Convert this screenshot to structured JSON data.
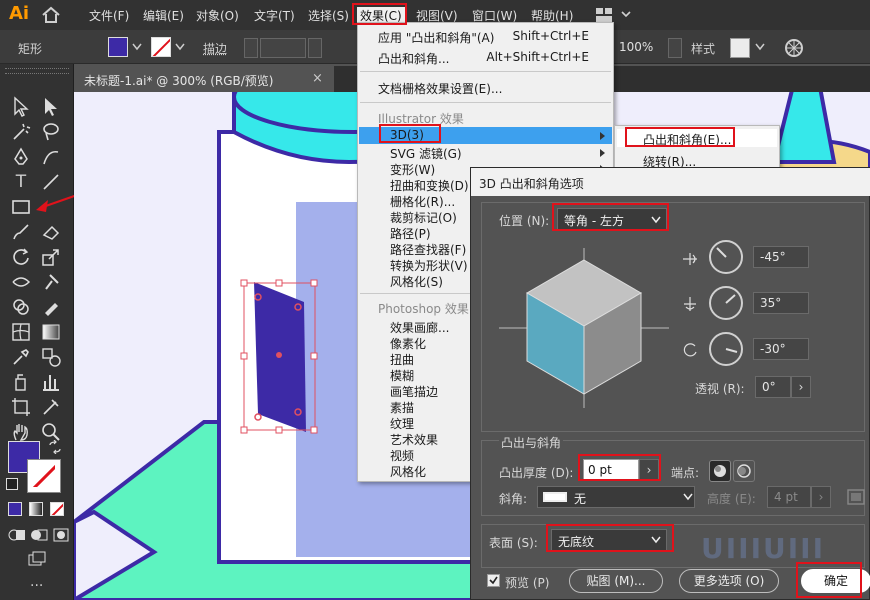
{
  "app": {
    "logo": "Ai",
    "home_icon": "home-icon"
  },
  "menubar": {
    "items": [
      {
        "label": "文件(F)"
      },
      {
        "label": "编辑(E)"
      },
      {
        "label": "对象(O)"
      },
      {
        "label": "文字(T)"
      },
      {
        "label": "选择(S)"
      },
      {
        "label": "效果(C)"
      },
      {
        "label": "视图(V)"
      },
      {
        "label": "窗口(W)"
      },
      {
        "label": "帮助(H)"
      }
    ]
  },
  "controlbar": {
    "object_type": "矩形",
    "stroke_label": "描边",
    "zoom": "100%",
    "style_label": "样式",
    "fill_color": "#3d2aa6"
  },
  "document_tab": {
    "title": "未标题-1.ai* @ 300% (RGB/预览)",
    "close": "×"
  },
  "effect_menu": {
    "apply": {
      "label": "应用 \"凸出和斜角\"(A)",
      "shortcut": "Shift+Ctrl+E"
    },
    "last": {
      "label": "凸出和斜角...",
      "shortcut": "Alt+Shift+Ctrl+E"
    },
    "raster_settings": "文档栅格效果设置(E)...",
    "illustrator_header": "Illustrator 效果",
    "illustrator_items": [
      "3D(3)",
      "SVG 滤镜(G)",
      "变形(W)",
      "扭曲和变换(D)",
      "栅格化(R)...",
      "裁剪标记(O)",
      "路径(P)",
      "路径查找器(F)",
      "转换为形状(V)",
      "风格化(S)"
    ],
    "photoshop_header": "Photoshop 效果",
    "photoshop_items": [
      "效果画廊...",
      "像素化",
      "扭曲",
      "模糊",
      "画笔描边",
      "素描",
      "纹理",
      "艺术效果",
      "视频",
      "风格化"
    ]
  },
  "submenu_3d": {
    "items": [
      "凸出和斜角(E)...",
      "绕转(R)..."
    ]
  },
  "dialog": {
    "title": "3D 凸出和斜角选项",
    "position_label": "位置 (N):",
    "position_value": "等角 - 左方",
    "rot_x": "-45°",
    "rot_y": "35°",
    "rot_z": "-30°",
    "perspective_label": "透视 (R):",
    "perspective_value": "0°",
    "extrude_section": "凸出与斜角",
    "extrude_depth_label": "凸出厚度 (D):",
    "extrude_depth_value": "0 pt",
    "cap_label": "端点:",
    "bevel_label": "斜角:",
    "bevel_value": "无",
    "height_label": "高度 (E):",
    "height_value": "4 pt",
    "surface_label": "表面 (S):",
    "surface_value": "无底纹",
    "preview_label": "预览 (P)",
    "map_art_label": "贴图 (M)...",
    "more_options_label": "更多选项 (O)",
    "ok_label": "确定",
    "watermark": "UIIIUIII"
  },
  "colors": {
    "accent_red": "#e0121b",
    "purple": "#3d2aa6",
    "cyan": "#36e8ea",
    "mint": "#5df3c0",
    "periwinkle": "#a4b0ec",
    "canvas": "#efeefc",
    "cube_left": "#5aa9c0",
    "cube_right": "#8c8c8c",
    "cube_top": "#c2c2c2"
  }
}
